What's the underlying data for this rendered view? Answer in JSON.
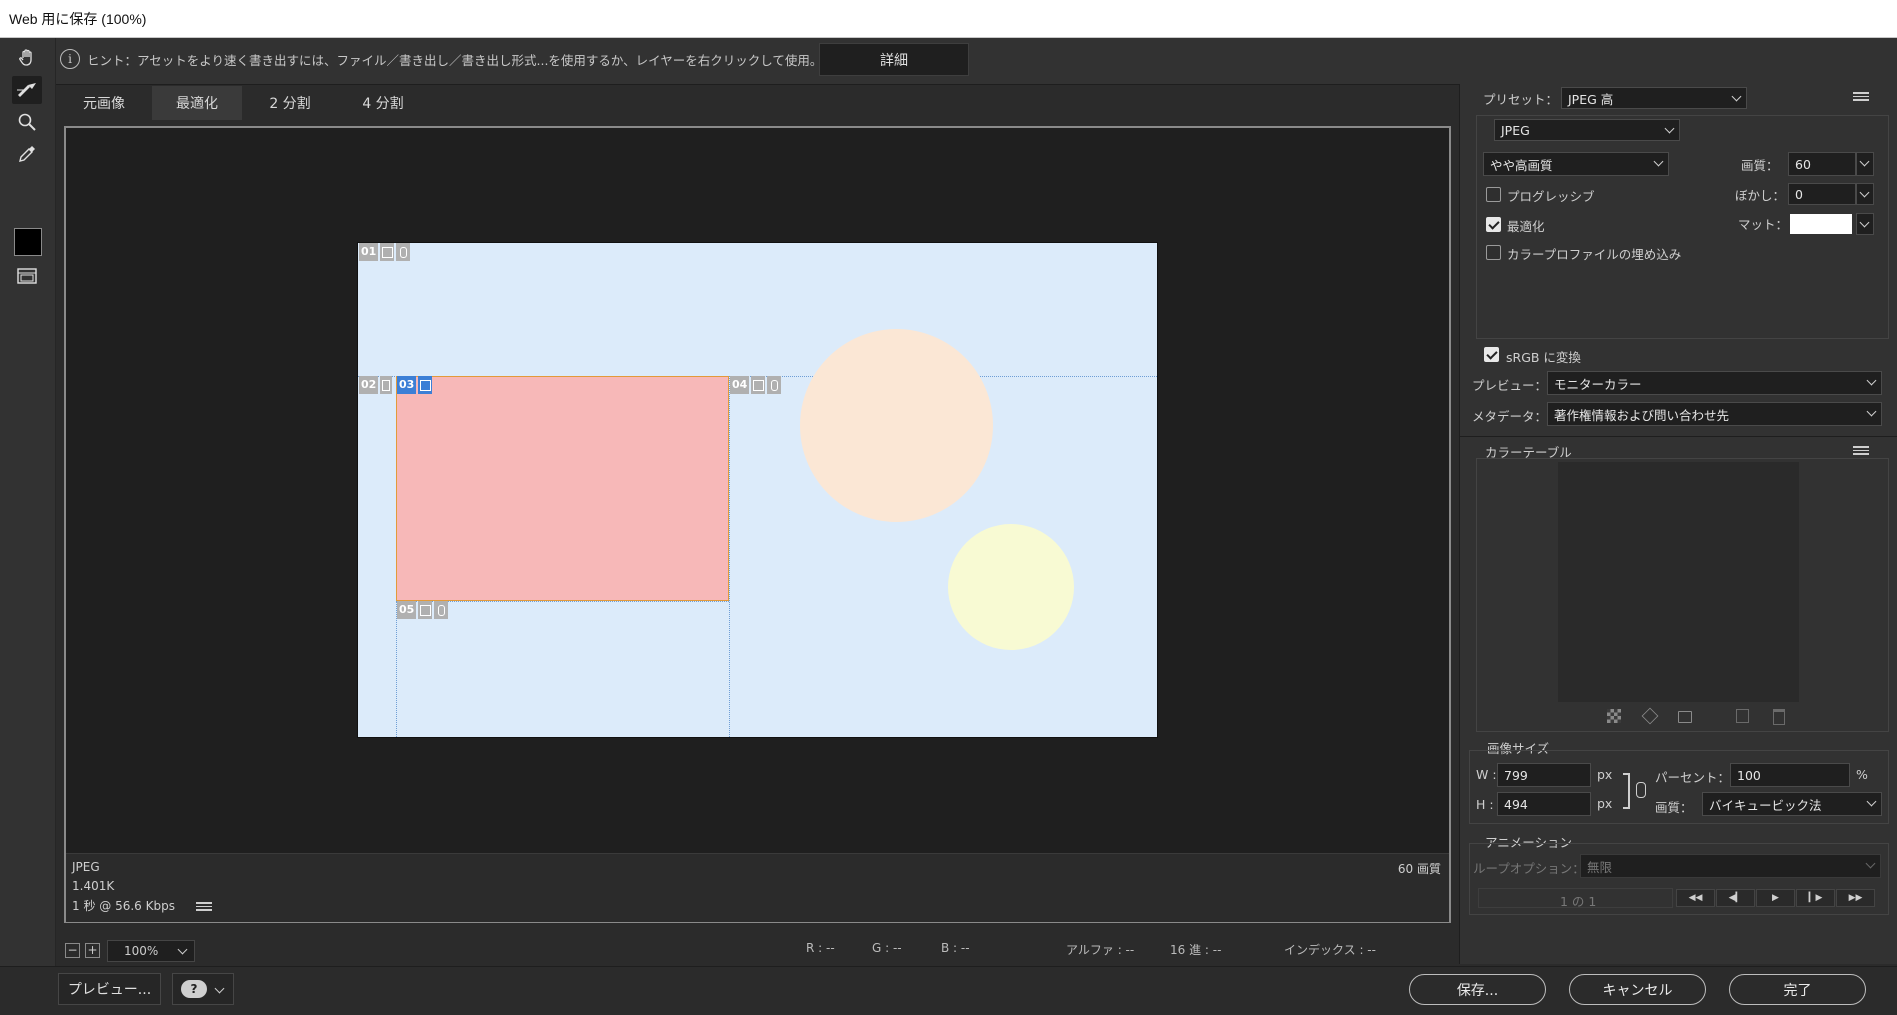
{
  "window": {
    "title": "Web 用に保存 (100%)"
  },
  "hint": {
    "icon": "info-icon",
    "text": "ヒント：アセットをより速く書き出すには、ファイル／書き出し／書き出し形式...を使用するか、レイヤーを右クリックして使用。",
    "detail_button": "詳細"
  },
  "tools": [
    {
      "name": "hand-icon"
    },
    {
      "name": "slice-select-icon",
      "active": true
    },
    {
      "name": "zoom-icon"
    },
    {
      "name": "eyedropper-icon"
    }
  ],
  "tabs": [
    "元画像",
    "最適化",
    "2 分割",
    "4 分割"
  ],
  "active_tab": "最適化",
  "slices": [
    "01",
    "02",
    "03",
    "04",
    "05"
  ],
  "canvas_colors": {
    "background": "#dcebfa",
    "slice03_fill": "#f7b8b8",
    "circle_peach": "#fbe7d5",
    "circle_yellow": "#f8fad3"
  },
  "preview_info": {
    "format": "JPEG",
    "size": "1.401K",
    "speed": "1 秒 @ 56.6 Kbps",
    "quality_label": "60 画質"
  },
  "zoom": {
    "value": "100%",
    "minus": "−",
    "plus": "+"
  },
  "readouts": {
    "r": "R : --",
    "g": "G : --",
    "b": "B : --",
    "alpha": "アルファ : --",
    "hex": "16 進 : --",
    "index": "インデックス : --"
  },
  "bottom": {
    "preview_button": "プレビュー...",
    "save_button": "保存...",
    "cancel_button": "キャンセル",
    "done_button": "完了"
  },
  "settings": {
    "preset_label": "プリセット：",
    "preset_value": "JPEG 高",
    "format_value": "JPEG",
    "quality_preset": "やや高画質",
    "quality_label": "画質：",
    "quality_value": "60",
    "blur_label": "ぼかし：",
    "blur_value": "0",
    "matte_label": "マット：",
    "matte_color": "#ffffff",
    "progressive_label": "プログレッシブ",
    "progressive_checked": false,
    "optimized_label": "最適化",
    "optimized_checked": true,
    "embed_profile_label": "カラープロファイルの埋め込み",
    "embed_profile_checked": false,
    "srgb_label": "sRGB に変換",
    "srgb_checked": true,
    "preview_label": "プレビュー：",
    "preview_value": "モニターカラー",
    "metadata_label": "メタデータ：",
    "metadata_value": "著作権情報および問い合わせ先"
  },
  "color_table": {
    "title": "カラーテーブル"
  },
  "image_size": {
    "title": "画像サイズ",
    "w_label": "W :",
    "w_value": "799",
    "h_label": "H :",
    "h_value": "494",
    "unit": "px",
    "percent_label": "パーセント：",
    "percent_value": "100",
    "percent_unit": "%",
    "quality_label": "画質：",
    "quality_value": "バイキュービック法"
  },
  "animation": {
    "title": "アニメーション",
    "loop_label": "ループオプション：",
    "loop_value": "無限",
    "frame_counter": "1 の 1"
  }
}
